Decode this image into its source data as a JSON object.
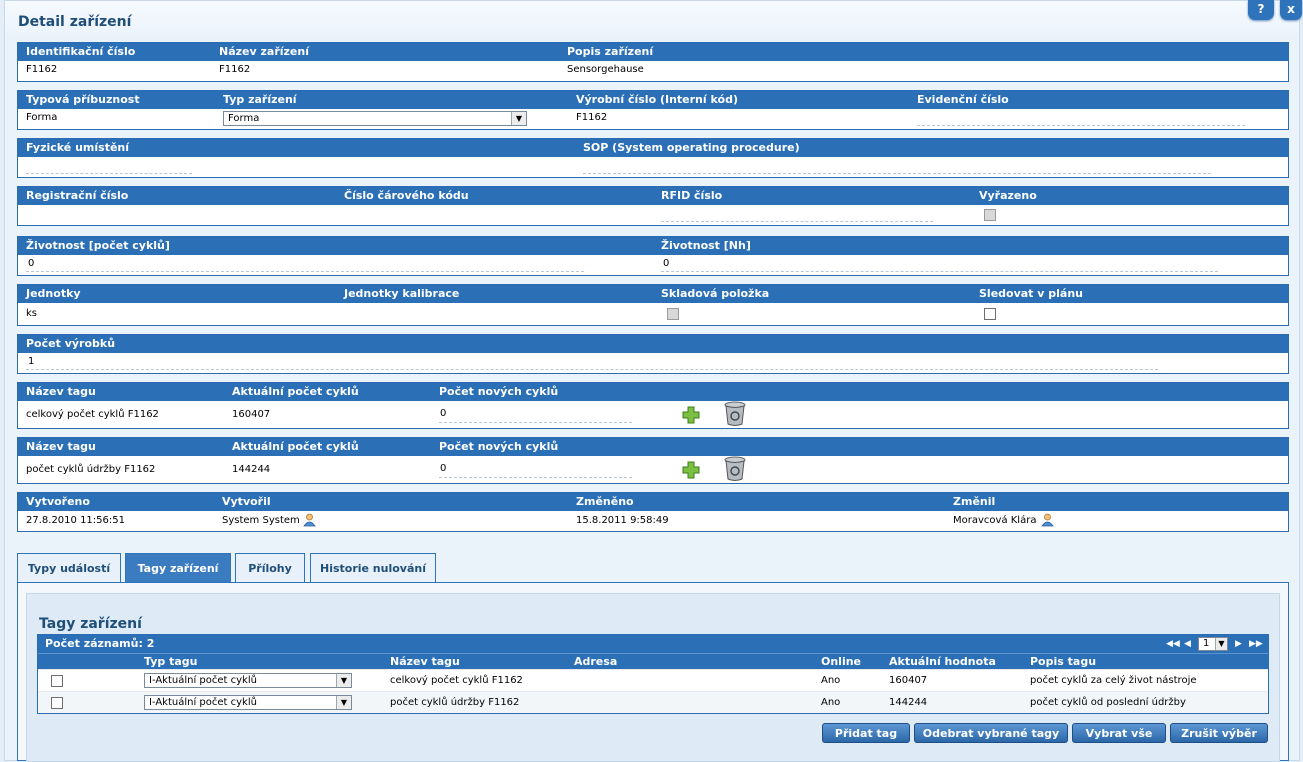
{
  "page": {
    "title": "Detail zařízení",
    "help_label": "?",
    "close_label": "x"
  },
  "ident": {
    "headers": [
      "Identifikační číslo",
      "Název zařízení",
      "Popis zařízení"
    ],
    "values": [
      "F1162",
      "F1162",
      "Sensorgehause"
    ]
  },
  "typ": {
    "headers": [
      "Typová příbuznost",
      "Typ zařízení",
      "Výrobní číslo (Interní kód)",
      "Evidenční číslo"
    ],
    "values": [
      "Forma",
      "Forma",
      "F1162",
      ""
    ]
  },
  "umisteni": {
    "headers": [
      "Fyzické umístění",
      "SOP (System operating procedure)"
    ]
  },
  "registrace": {
    "headers": [
      "Registrační číslo",
      "Číslo čárového kódu",
      "RFID číslo",
      "Vyřazeno"
    ]
  },
  "zivotnost": {
    "headers": [
      "Životnost [počet cyklů]",
      "Životnost [Nh]"
    ],
    "values": [
      "0",
      "0"
    ]
  },
  "jednotky": {
    "headers": [
      "Jednotky",
      "Jednotky kalibrace",
      "Skladová položka",
      "Sledovat v plánu"
    ],
    "values": [
      "ks"
    ]
  },
  "vyrobky": {
    "header": "Počet výrobků",
    "value": "1"
  },
  "tags": [
    {
      "headers": [
        "Název tagu",
        "Aktuální počet cyklů",
        "Počet nových cyklů"
      ],
      "name": "celkový počet cyklů F1162",
      "current": "160407",
      "new": "0"
    },
    {
      "headers": [
        "Název tagu",
        "Aktuální počet cyklů",
        "Počet nových cyklů"
      ],
      "name": "počet cyklů údržby F1162",
      "current": "144244",
      "new": "0"
    }
  ],
  "audit": {
    "headers": [
      "Vytvořeno",
      "Vytvořil",
      "Změněno",
      "Změnil"
    ],
    "created": "27.8.2010 11:56:51",
    "created_by": "System System",
    "changed": "15.8.2011 9:58:49",
    "changed_by": "Moravcová Klára"
  },
  "tabs": [
    "Typy událostí",
    "Tagy zařízení",
    "Přílohy",
    "Historie nulování"
  ],
  "tag_panel": {
    "title": "Tagy zařízení",
    "count_label": "Počet záznamů: 2",
    "page": "1",
    "columns": [
      "Typ tagu",
      "Název tagu",
      "Adresa",
      "Online",
      "Aktuální hodnota",
      "Popis tagu"
    ],
    "rows": [
      {
        "type": "I-Aktuální počet cyklů",
        "name": "celkový počet cyklů F1162",
        "address": "",
        "online": "Ano",
        "value": "160407",
        "desc": "počet cyklů za celý život nástroje"
      },
      {
        "type": "I-Aktuální počet cyklů",
        "name": "počet cyklů údržby F1162",
        "address": "",
        "online": "Ano",
        "value": "144244",
        "desc": "počet cyklů od poslední údržby"
      }
    ],
    "buttons": [
      "Přidat tag",
      "Odebrat vybrané tagy",
      "Vybrat vše",
      "Zrušit výběr"
    ]
  }
}
